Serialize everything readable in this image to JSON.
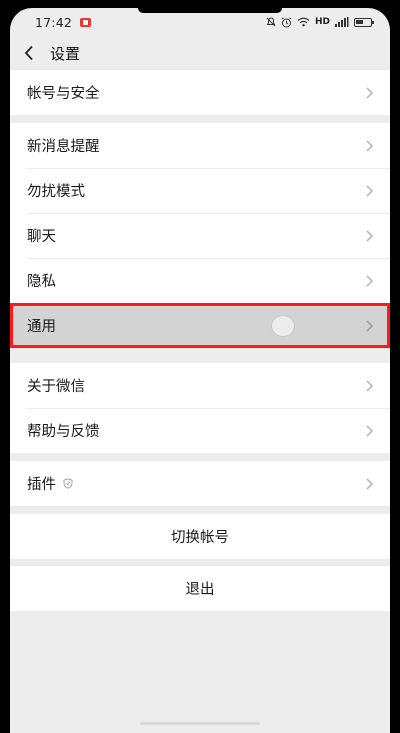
{
  "status_bar": {
    "time": "17:42",
    "network_label": "HD",
    "icons": [
      "screen-record-icon",
      "mute-icon",
      "alarm-icon",
      "wifi-icon",
      "signal-icon",
      "battery-icon"
    ]
  },
  "nav": {
    "title": "设置",
    "back_icon": "chevron-left-icon"
  },
  "groups": [
    {
      "items": [
        {
          "label": "帐号与安全"
        }
      ]
    },
    {
      "items": [
        {
          "label": "新消息提醒"
        },
        {
          "label": "勿扰模式"
        },
        {
          "label": "聊天"
        },
        {
          "label": "隐私"
        },
        {
          "label": "通用",
          "highlighted": true
        }
      ]
    },
    {
      "items": [
        {
          "label": "关于微信"
        },
        {
          "label": "帮助与反馈"
        }
      ]
    },
    {
      "items": [
        {
          "label": "插件",
          "icon": "shield-icon"
        }
      ]
    }
  ],
  "actions": {
    "switch_account": "切换帐号",
    "logout": "退出"
  },
  "colors": {
    "page_background": "#ededed",
    "highlight_border": "#ff1a1a",
    "highlight_fill": "#d3d3d3",
    "record_indicator": "#e53935"
  }
}
